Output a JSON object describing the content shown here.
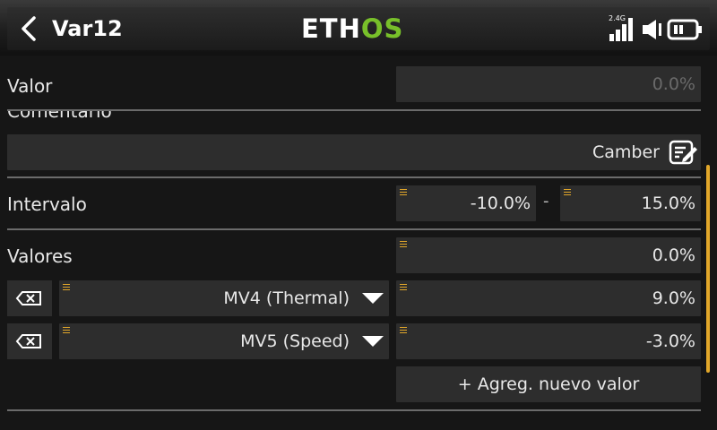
{
  "header": {
    "title": "Var12",
    "logo_part1": "ETH",
    "logo_part2": "OS",
    "signal_label": "2.4G"
  },
  "rows": {
    "valor": {
      "label": "Valor",
      "value": "0.0%"
    },
    "comentario": {
      "label": "Comentario",
      "value": "Camber"
    },
    "intervalo": {
      "label": "Intervalo",
      "min": "-10.0%",
      "separator": "-",
      "max": "15.0%"
    },
    "valores": {
      "label": "Valores",
      "default_value": "0.0%"
    }
  },
  "values_list": [
    {
      "source": "MV4 (Thermal)",
      "value": "9.0%"
    },
    {
      "source": "MV5 (Speed)",
      "value": "-3.0%"
    }
  ],
  "add_button_label": "+ Agreg. nuevo valor",
  "colors": {
    "accent": "#e2a72a",
    "logo_green": "#78c02a",
    "field_bg": "#2d2d2d",
    "background": "#161616"
  }
}
